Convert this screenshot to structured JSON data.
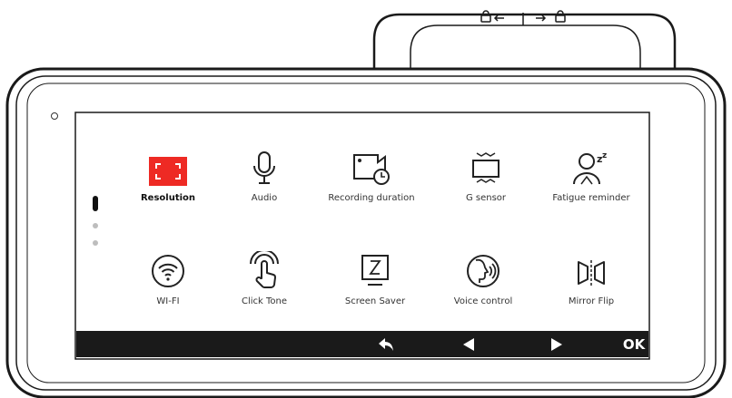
{
  "menu": {
    "items": [
      {
        "label": "Resolution",
        "icon": "resolution-icon"
      },
      {
        "label": "Audio",
        "icon": "microphone-icon"
      },
      {
        "label": "Recording duration",
        "icon": "recording-duration-icon"
      },
      {
        "label": "G sensor",
        "icon": "g-sensor-icon"
      },
      {
        "label": "Fatigue reminder",
        "icon": "fatigue-icon"
      },
      {
        "label": "WI-FI",
        "icon": "wifi-icon"
      },
      {
        "label": "Click Tone",
        "icon": "click-tone-icon"
      },
      {
        "label": "Screen Saver",
        "icon": "screen-saver-icon"
      },
      {
        "label": "Voice control",
        "icon": "voice-control-icon"
      },
      {
        "label": "Mirror Flip",
        "icon": "mirror-flip-icon"
      }
    ],
    "active_index": 0,
    "page": 1,
    "page_count": 3
  },
  "bottom_bar": {
    "ok_label": "OK"
  },
  "colors": {
    "accent": "#ee2a24",
    "bar": "#1a1a1a",
    "frame": "#1a1a1a"
  }
}
